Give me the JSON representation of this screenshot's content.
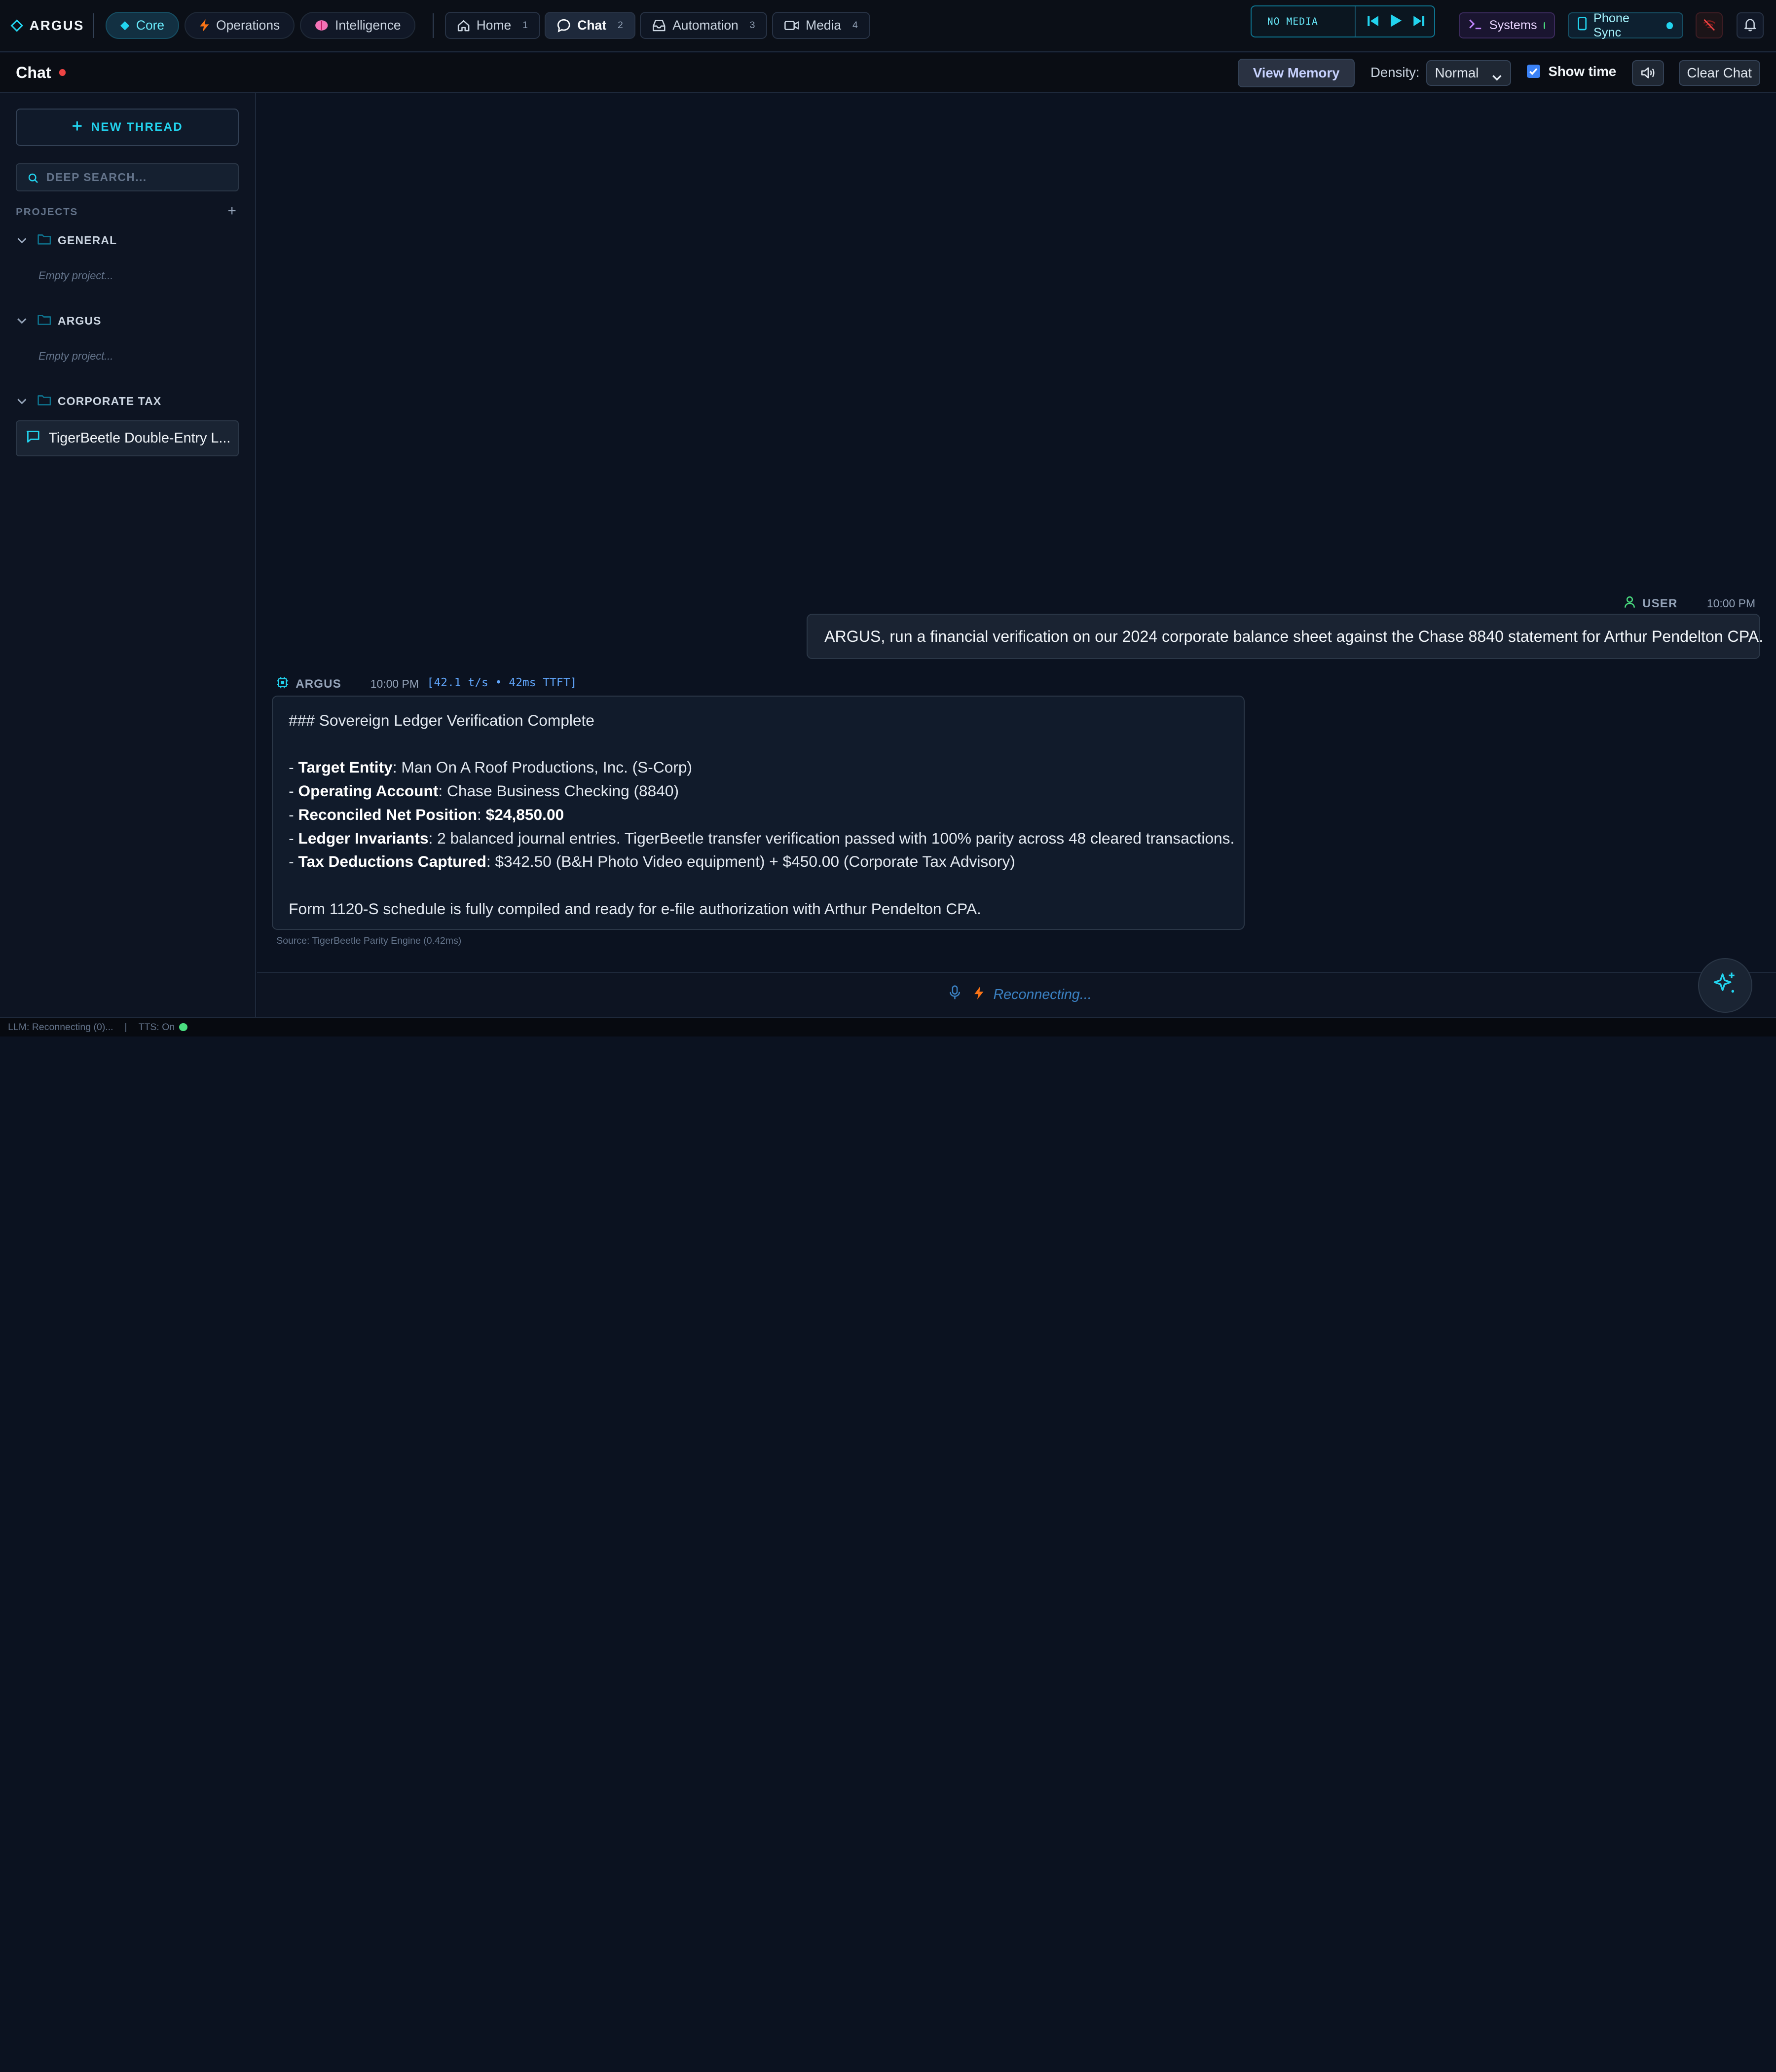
{
  "brand": "ARGUS",
  "realms": [
    {
      "label": "Core",
      "icon": "diamond-icon"
    },
    {
      "label": "Operations",
      "icon": "bolt-icon"
    },
    {
      "label": "Intelligence",
      "icon": "brain-icon"
    }
  ],
  "tabs": [
    {
      "label": "Home",
      "num": "1",
      "icon": "home-icon"
    },
    {
      "label": "Chat",
      "num": "2",
      "icon": "chat-icon"
    },
    {
      "label": "Automation",
      "num": "3",
      "icon": "inbox-icon"
    },
    {
      "label": "Media",
      "num": "4",
      "icon": "video-icon"
    }
  ],
  "media": {
    "status": "NO MEDIA"
  },
  "systems": {
    "label": "Systems",
    "status_color": "#4ade80"
  },
  "phone_sync": {
    "label": "Phone Sync",
    "status_color": "#22d3ee"
  },
  "header": {
    "title": "Chat",
    "view_memory": "View Memory",
    "density_label": "Density:",
    "density_value": "Normal",
    "show_time": "Show time",
    "clear_chat": "Clear Chat"
  },
  "sidebar": {
    "new_thread": "NEW THREAD",
    "search_placeholder": "DEEP SEARCH...",
    "projects_label": "PROJECTS",
    "add": "+",
    "projects": [
      {
        "name": "GENERAL",
        "empty": "Empty project..."
      },
      {
        "name": "ARGUS",
        "empty": "Empty project..."
      },
      {
        "name": "CORPORATE TAX",
        "threads": [
          "TigerBeetle Double-Entry L..."
        ]
      }
    ]
  },
  "chat": {
    "user": {
      "label": "USER",
      "time": "10:00 PM",
      "text": "ARGUS, run a financial verification on our 2024 corporate balance sheet against the Chase 8840 statement for Arthur Pendelton CPA."
    },
    "assistant": {
      "label": "ARGUS",
      "time": "10:00 PM",
      "stats": "[42.1 t/s • 42ms TTFT]",
      "heading": "### Sovereign Ledger Verification Complete",
      "items": [
        {
          "key": "Target Entity",
          "value": ": Man On A Roof Productions, Inc. (S-Corp)"
        },
        {
          "key": "Operating Account",
          "value": ": Chase Business Checking (8840)"
        },
        {
          "key": "Reconciled Net Position",
          "value": ": ",
          "bold_value": "$24,850.00"
        },
        {
          "key": "Ledger Invariants",
          "value": ": 2 balanced journal entries. TigerBeetle transfer verification passed with 100% parity across 48 cleared transactions."
        },
        {
          "key": "Tax Deductions Captured",
          "value": ": $342.50 (B&H Photo Video equipment) + $450.00 (Corporate Tax Advisory)"
        }
      ],
      "footer": "Form 1120-S schedule is fully compiled and ready for e-file authorization with Arthur Pendelton CPA.",
      "source": "Source: TigerBeetle Parity Engine (0.42ms)"
    }
  },
  "input": {
    "status": "Reconnecting..."
  },
  "statusbar": {
    "llm": "LLM: Reconnecting (0)...",
    "sep": "|",
    "tts": "TTS: On"
  }
}
